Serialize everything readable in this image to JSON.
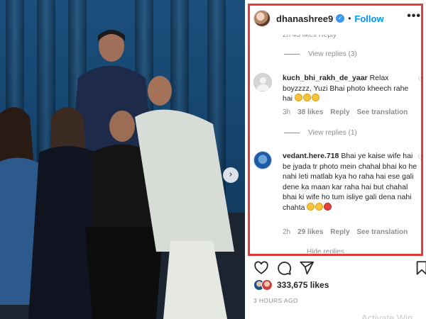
{
  "post": {
    "username": "dhanashree9",
    "separator": "•",
    "follow_label": "Follow",
    "more_glyph": "•••",
    "carousel_next_glyph": "›"
  },
  "cutoff_row": "2h    43 likes   Reply",
  "threads": [
    {
      "view_replies": "View replies (3)"
    },
    {
      "username": "kuch_bhi_rakh_de_yaar",
      "text": "Relax boyzzzz, Yuzi Bhai photo kheech rahe hai",
      "emoji": [
        "face-with-tears-of-joy",
        "face-with-tears-of-joy",
        "face-with-tears-of-joy"
      ],
      "time": "3h",
      "likes": "38 likes",
      "reply": "Reply",
      "see_translation": "See translation",
      "view_replies": "View replies (1)"
    },
    {
      "username": "vedant.here.718",
      "text": "Bhai ye kaise wife hai be jyada tr photo mein chahal bhai ko he nahi leti matlab kya ho raha hai ese gali dene ka maan kar raha hai but chahal bhai ki wife ho tum isliye gali dena nahi chahta",
      "emoji": [
        "face-screaming-in-fear",
        "face-screaming-in-fear",
        "pouting-face"
      ],
      "time": "2h",
      "likes": "29 likes",
      "reply": "Reply",
      "see_translation": "See translation"
    }
  ],
  "hide_replies": "Hide replies",
  "likes_count": "333,675 likes",
  "time_ago": "3 HOURS AGO",
  "watermark": "Activate Win",
  "colors": {
    "accent": "#0095f6",
    "highlight_border": "#e23b3b",
    "muted_text": "#8e8e8e"
  }
}
